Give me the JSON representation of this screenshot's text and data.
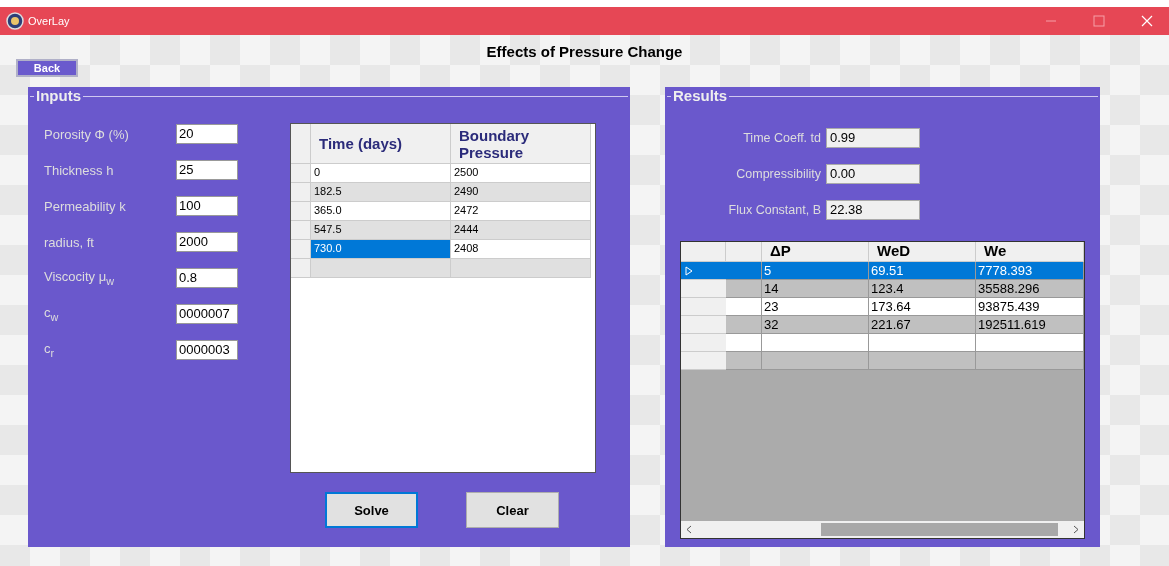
{
  "window": {
    "title": "OverLay"
  },
  "heading": "Effects of Pressure Change",
  "back_button": "Back",
  "inputs": {
    "title": "Inputs",
    "fields": [
      {
        "label": "Porosity Φ (%)",
        "value": "20"
      },
      {
        "label": "Thickness h",
        "value": "25"
      },
      {
        "label": "Permeability k",
        "value": "100"
      },
      {
        "label": "radius, ft",
        "value": "2000"
      },
      {
        "label": "Viscocity μ$_{w}$",
        "value": "0.8"
      },
      {
        "label": "c$_{w}$",
        "value": "0000007"
      },
      {
        "label": "c$_{r}$",
        "value": "0000003"
      }
    ],
    "table": {
      "columns": [
        "Time (days)",
        "Boundary Pressure"
      ],
      "rows": [
        {
          "cells": [
            "0",
            "2500"
          ],
          "selected": false
        },
        {
          "cells": [
            "182.5",
            "2490"
          ],
          "selected": false
        },
        {
          "cells": [
            "365.0",
            "2472"
          ],
          "selected": false
        },
        {
          "cells": [
            "547.5",
            "2444"
          ],
          "selected": false
        },
        {
          "cells": [
            "730.0",
            "2408"
          ],
          "selected": true
        }
      ]
    },
    "buttons": [
      {
        "label": "Solve",
        "focused": true
      },
      {
        "label": "Clear",
        "focused": false
      }
    ]
  },
  "results": {
    "title": "Results",
    "fields": [
      {
        "label": "Time Coeff. td",
        "value": "0.99"
      },
      {
        "label": "Compressibility",
        "value": "0.00"
      },
      {
        "label": "Flux Constant, B",
        "value": "22.38"
      }
    ],
    "table": {
      "columns": [
        "ΔP",
        "WeD",
        "We"
      ],
      "rows": [
        {
          "cells": [
            "5",
            "69.51",
            "7778.393"
          ],
          "selected": true
        },
        {
          "cells": [
            "14",
            "123.4",
            "35588.296"
          ],
          "selected": false
        },
        {
          "cells": [
            "23",
            "173.64",
            "93875.439"
          ],
          "selected": false
        },
        {
          "cells": [
            "32",
            "221.67",
            "192511.619"
          ],
          "selected": false
        }
      ]
    }
  }
}
